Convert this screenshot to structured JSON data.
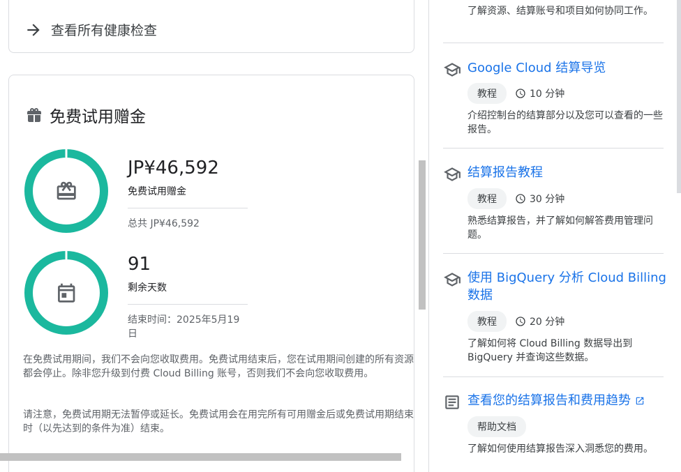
{
  "left": {
    "health_link": "查看所有健康检查",
    "card_title": "免费试用赠金",
    "credit": {
      "amount": "JP¥46,592",
      "label": "免费试用赠金",
      "total": "总共 JP¥46,592",
      "progress": 1.0
    },
    "days": {
      "value": "91",
      "label": "剩余天数",
      "end": "结束时间：2025年5月19日",
      "progress": 1.0
    },
    "para1": "在免费试用期间，我们不会向您收取费用。免费试用结束后，您在试用期间创建的所有资源都会停止。除非您升级到付费 Cloud Billing 账号，否则我们不会向您收取费用。",
    "para2": "请注意，免费试用期无法暂停或延长。免费试用会在用完所有可用赠金后或免费试用期结束时（以先达到的条件为准）结束。"
  },
  "right": {
    "top_desc": "了解资源、结算账号和项目如何协同工作。",
    "items": [
      {
        "title": "Google Cloud 结算导览",
        "chip": "教程",
        "duration": "10 分钟",
        "desc": "介绍控制台的结算部分以及您可以查看的一些报告。",
        "icon": "school-icon"
      },
      {
        "title": "结算报告教程",
        "chip": "教程",
        "duration": "30 分钟",
        "desc": "熟悉结算报告，并了解如何解答费用管理问题。",
        "icon": "school-icon"
      },
      {
        "title": "使用 BigQuery 分析 Cloud Billing 数据",
        "chip": "教程",
        "duration": "20 分钟",
        "desc": "了解如何将 Cloud Billing 数据导出到 BigQuery 并查询这些数据。",
        "icon": "school-icon"
      },
      {
        "title": "查看您的结算报告和费用趋势",
        "chip": "帮助文档",
        "desc": "了解如何使用结算报告深入洞悉您的费用。",
        "icon": "article-icon"
      }
    ]
  },
  "colors": {
    "ring": "#1bb89e",
    "link": "#1a73e8",
    "icon": "#5f6368"
  }
}
